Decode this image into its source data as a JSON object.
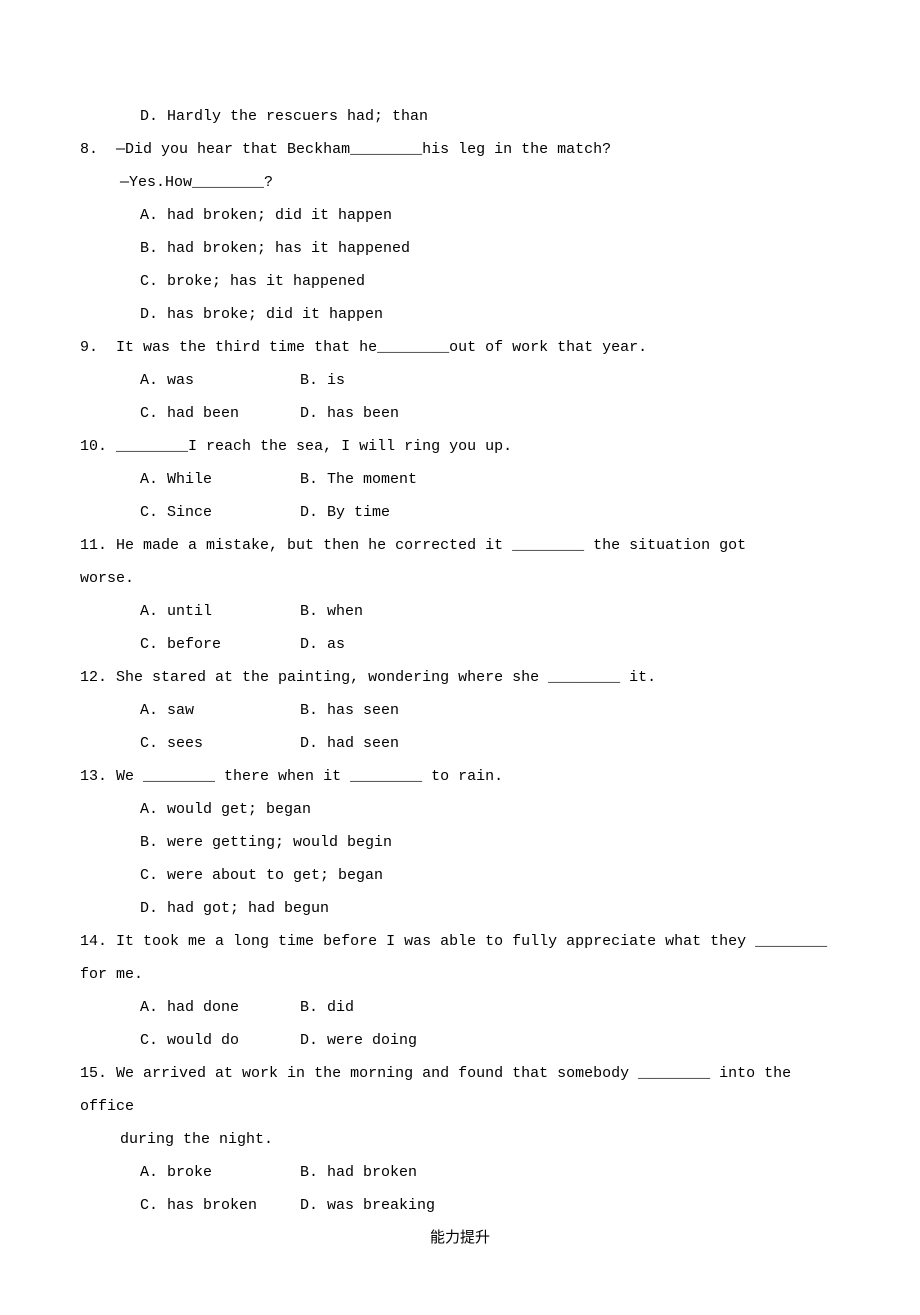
{
  "q7": {
    "optD": "D. Hardly the rescuers had; than"
  },
  "q8": {
    "num": "8.",
    "stem1": "—Did you hear that Beckham________his leg in the match?",
    "stem2": "—Yes.How________?",
    "optA": "A. had broken; did it happen",
    "optB": "B. had broken; has it happened",
    "optC": "C. broke; has it happened",
    "optD": "D. has broke; did it happen"
  },
  "q9": {
    "num": "9.",
    "stem": "It was the third time that he________out of work that year.",
    "optA": "A. was",
    "optB": "B. is",
    "optC": "C. had been",
    "optD": "D. has been"
  },
  "q10": {
    "num": "10.",
    "stem": "________I reach the sea, I will ring you up.",
    "optA": "A. While",
    "optB": "B. The moment",
    "optC": "C. Since",
    "optD": "D. By time"
  },
  "q11": {
    "num": "11.",
    "stem": "He made a mistake, but then he corrected it ________ the situation got",
    "stem2": "worse.",
    "optA": "A. until",
    "optB": "B. when",
    "optC": "C. before",
    "optD": "D. as"
  },
  "q12": {
    "num": "12.",
    "stem": "She stared at the painting, wondering where she ________ it.",
    "optA": "A. saw",
    "optB": "B. has seen",
    "optC": "C. sees",
    "optD": "D. had seen"
  },
  "q13": {
    "num": "13.",
    "stem": "We ________ there when it ________ to rain.",
    "optA": "A. would get; began",
    "optB": "B. were getting; would begin",
    "optC": "C. were about to get; began",
    "optD": "D. had got; had begun"
  },
  "q14": {
    "num": "14.",
    "stem": "It took me a long time before I was able to fully appreciate what they ________",
    "stem2": "for me.",
    "optA": "A. had done",
    "optB": "B. did",
    "optC": "C. would do",
    "optD": "D. were doing"
  },
  "q15": {
    "num": "15.",
    "stem": "We arrived at work in the morning and found that somebody ________ into the office",
    "stem2": "during the night.",
    "optA": "A. broke",
    "optB": "B. had broken",
    "optC": "C. has broken",
    "optD": "D. was breaking"
  },
  "footer_title": "能力提升"
}
